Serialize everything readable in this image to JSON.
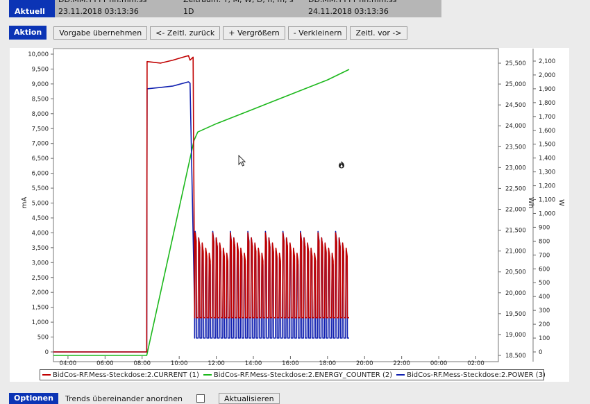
{
  "header": {
    "rows": [
      {
        "label": "",
        "from": "DD.MM.YYYY hh:mm:ss",
        "range": "Zeitraum: Y, M, W, D, h, m, s",
        "to": "DD.MM.YYYY hh:mm:ss"
      },
      {
        "label": "Aktuell",
        "from": "23.11.2018 03:13:36",
        "range": "1D",
        "to": "24.11.2018 03:13:36"
      }
    ]
  },
  "actions": {
    "tag": "Aktion",
    "buttons": [
      "Vorgabe übernehmen",
      "<- Zeitl. zurück",
      "+ Vergrößern",
      "- Verkleinern",
      "Zeitl. vor ->"
    ]
  },
  "options": {
    "tag": "Optionen",
    "label": "Trends übereinander anordnen",
    "button": "Aktualisieren"
  },
  "chart_data": {
    "type": "line",
    "x_ticks": [
      "04:00",
      "06:00",
      "08:00",
      "10:00",
      "12:00",
      "14:00",
      "16:00",
      "18:00",
      "20:00",
      "22:00",
      "00:00",
      "02:00"
    ],
    "x_range": [
      "03:13",
      "03:13 (+1d)"
    ],
    "axes": {
      "left": {
        "label": "mA",
        "min": 0,
        "max": 10000,
        "ticks": [
          "0",
          "500",
          "1,000",
          "1,500",
          "2,000",
          "2,500",
          "3,000",
          "3,500",
          "4,000",
          "4,500",
          "5,000",
          "5,500",
          "6,000",
          "6,500",
          "7,000",
          "7,500",
          "8,000",
          "8,500",
          "9,000",
          "9,500",
          "10,000"
        ]
      },
      "middle": {
        "label": "Wh",
        "min": 18500,
        "max": 25500,
        "ticks": [
          "18,500",
          "19,000",
          "19,500",
          "20,000",
          "20,500",
          "21,000",
          "21,500",
          "22,000",
          "22,500",
          "23,000",
          "23,500",
          "24,000",
          "24,500",
          "25,000",
          "25,500"
        ]
      },
      "right": {
        "label": "W",
        "min": 0,
        "max": 2100,
        "ticks": [
          "0",
          "100",
          "200",
          "300",
          "400",
          "500",
          "600",
          "700",
          "800",
          "900",
          "1,000",
          "1,100",
          "1,200",
          "1,300",
          "1,400",
          "1,500",
          "1,600",
          "1,700",
          "1,800",
          "1,900",
          "2,000",
          "2,100"
        ]
      }
    },
    "grid": false,
    "legend_position": "bottom",
    "series": [
      {
        "name": "BidCos-RF.Mess-Steckdose:2.CURRENT (1)",
        "color": "#c00000",
        "axis": "left",
        "points": [
          [
            "03:13",
            0
          ],
          [
            "08:15",
            0
          ],
          [
            "08:16",
            9750
          ],
          [
            "09:00",
            9700
          ],
          [
            "09:40",
            9800
          ],
          [
            "10:30",
            9950
          ],
          [
            "10:35",
            9800
          ],
          [
            "10:45",
            9900
          ],
          [
            "10:50",
            1500
          ]
        ],
        "pulse": {
          "from": "10:50",
          "to": "19:10",
          "low": 1150,
          "high": 4000
        }
      },
      {
        "name": "BidCos-RF.Mess-Steckdose:2.ENERGY_COUNTER (2)",
        "color": "#1cb81c",
        "axis": "middle",
        "points": [
          [
            "03:13",
            18500
          ],
          [
            "08:15",
            18500
          ],
          [
            "10:48",
            23650
          ],
          [
            "11:00",
            23850
          ],
          [
            "12:00",
            24050
          ],
          [
            "14:00",
            24400
          ],
          [
            "16:00",
            24750
          ],
          [
            "18:00",
            25100
          ],
          [
            "19:10",
            25350
          ]
        ]
      },
      {
        "name": "BidCos-RF.Mess-Steckdose:2.POWER (3)",
        "color": "#1020b0",
        "axis": "right",
        "points": [
          [
            "03:13",
            0
          ],
          [
            "08:15",
            0
          ],
          [
            "08:16",
            1900
          ],
          [
            "09:00",
            1910
          ],
          [
            "09:40",
            1920
          ],
          [
            "10:30",
            1950
          ],
          [
            "10:35",
            1940
          ],
          [
            "10:50",
            300
          ]
        ],
        "pulse": {
          "from": "10:50",
          "to": "19:10",
          "low": 100,
          "high": 870
        }
      }
    ]
  }
}
